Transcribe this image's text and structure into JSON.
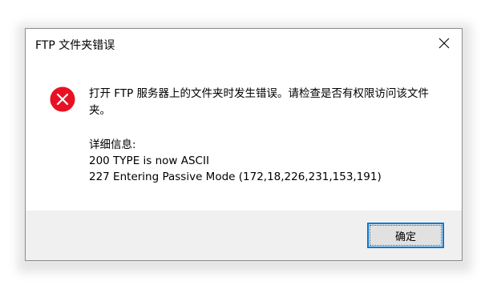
{
  "dialog": {
    "title": "FTP 文件夹错误",
    "message": "打开 FTP 服务器上的文件夹时发生错误。请检查是否有权限访问该文件夹。",
    "details_heading": "详细信息:",
    "details_lines": [
      "200 TYPE is now ASCII",
      "227 Entering Passive Mode (172,18,226,231,153,191)"
    ],
    "ok_label": "确定",
    "icon": "error-icon"
  },
  "colors": {
    "error_red": "#e81123",
    "focus_blue": "#0078d7",
    "footer_bg": "#f0f0f0",
    "button_bg": "#e1e1e1"
  }
}
